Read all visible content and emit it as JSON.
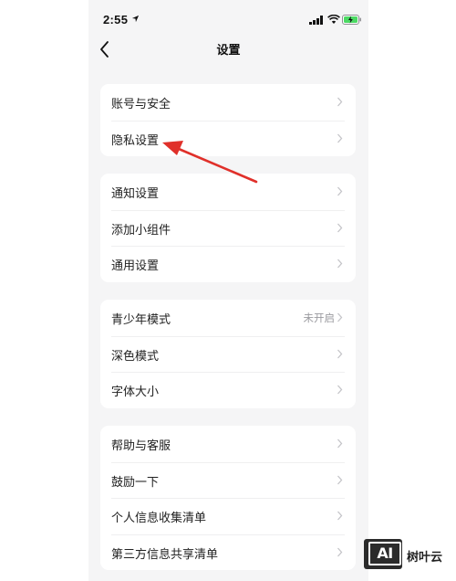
{
  "status_bar": {
    "time": "2:55"
  },
  "nav": {
    "title": "设置"
  },
  "groups": [
    [
      {
        "label": "账号与安全",
        "value": ""
      },
      {
        "label": "隐私设置",
        "value": ""
      }
    ],
    [
      {
        "label": "通知设置",
        "value": ""
      },
      {
        "label": "添加小组件",
        "value": ""
      },
      {
        "label": "通用设置",
        "value": ""
      }
    ],
    [
      {
        "label": "青少年模式",
        "value": "未开启"
      },
      {
        "label": "深色模式",
        "value": ""
      },
      {
        "label": "字体大小",
        "value": ""
      }
    ],
    [
      {
        "label": "帮助与客服",
        "value": ""
      },
      {
        "label": "鼓励一下",
        "value": ""
      },
      {
        "label": "个人信息收集清单",
        "value": ""
      },
      {
        "label": "第三方信息共享清单",
        "value": ""
      }
    ]
  ],
  "watermark": {
    "logo_text": "AI",
    "text": "树叶云"
  },
  "colors": {
    "annotation_arrow": "#e0302a",
    "background": "#f5f5f6"
  },
  "icons": [
    "location-arrow-icon",
    "signal-icon",
    "wifi-icon",
    "battery-charging-icon",
    "back-chevron-icon",
    "chevron-right-icon"
  ]
}
